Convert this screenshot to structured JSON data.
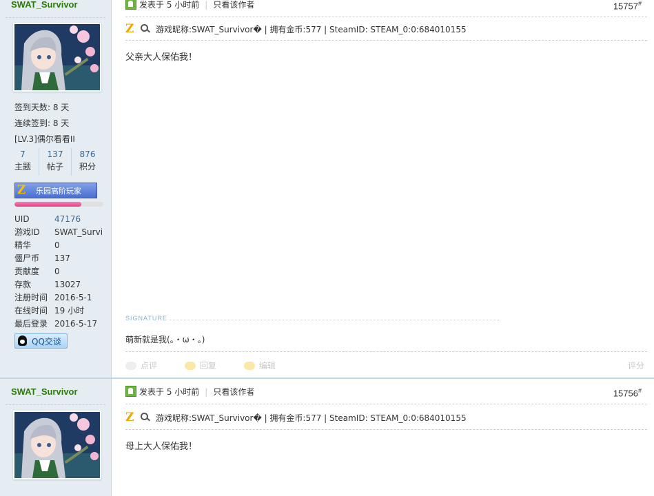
{
  "posts": [
    {
      "username": "SWAT_Survivor",
      "stats": {
        "signin_days": "签到天数: 8 天",
        "continuous_signin": "连续签到: 8 天",
        "level": "[LV.3]偶尔看看II"
      },
      "counts": [
        {
          "value": "7",
          "label": "主题"
        },
        {
          "value": "137",
          "label": "帖子"
        },
        {
          "value": "876",
          "label": "积分"
        }
      ],
      "medal_label": "乐园高阶玩家",
      "progress_fraction": 0.75,
      "details": [
        {
          "key": "UID",
          "value": "47176"
        },
        {
          "key": "游戏ID",
          "value": "SWAT_Survi"
        },
        {
          "key": "精华",
          "value": "0"
        },
        {
          "key": "僵尸币",
          "value": "137"
        },
        {
          "key": "贡献度",
          "value": "0"
        },
        {
          "key": "存款",
          "value": "13027"
        },
        {
          "key": "注册时间",
          "value": "2016-5-1"
        },
        {
          "key": "在线时间",
          "value": "19 小时"
        },
        {
          "key": "最后登录",
          "value": "2016-5-17"
        }
      ],
      "qq_label": "QQ交谈",
      "posted": "发表于 5 小时前",
      "author_only": "只看该作者",
      "floor": "15757",
      "game_info": "游戏昵称:SWAT_Survivor� | 拥有金币:577 | SteamID: STEAM_0:0:684010155",
      "content": "父亲大人保佑我！",
      "signature_title": "SIGNATURE",
      "signature": "萌新就是我(。・ω・。)",
      "actions": [
        "点评",
        "回复",
        "编辑"
      ],
      "rate": "评分"
    },
    {
      "username": "SWAT_Survivor",
      "posted": "发表于 5 小时前",
      "author_only": "只看该作者",
      "floor": "15756",
      "game_info": "游戏昵称:SWAT_Survivor� | 拥有金币:577 | SteamID: STEAM_0:0:684010155",
      "content": "母上大人保佑我！"
    }
  ],
  "floor_mark": "#",
  "logo_letter": "Z",
  "colors": {
    "username": "#2b7a0b",
    "sidebar_bg": "#e5edf2",
    "link": "#336699"
  }
}
